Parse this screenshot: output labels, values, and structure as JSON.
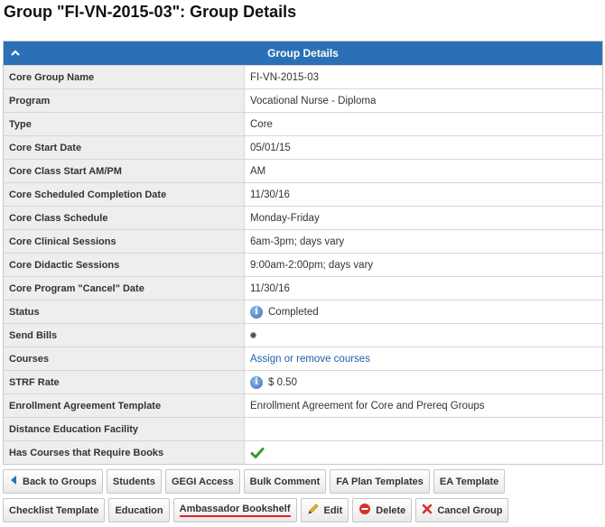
{
  "page": {
    "title": "Group \"FI-VN-2015-03\": Group Details"
  },
  "panel": {
    "header": "Group Details"
  },
  "details": [
    {
      "label": "Core Group Name",
      "value": "FI-VN-2015-03"
    },
    {
      "label": "Program",
      "value": "Vocational Nurse - Diploma"
    },
    {
      "label": "Type",
      "value": "Core"
    },
    {
      "label": "Core Start Date",
      "value": "05/01/15"
    },
    {
      "label": "Core Class Start AM/PM",
      "value": "AM"
    },
    {
      "label": "Core Scheduled Completion Date",
      "value": "11/30/16"
    },
    {
      "label": "Core Class Schedule",
      "value": "Monday-Friday"
    },
    {
      "label": "Core Clinical Sessions",
      "value": "6am-3pm; days vary"
    },
    {
      "label": "Core Didactic Sessions",
      "value": "9:00am-2:00pm; days vary"
    },
    {
      "label": "Core Program \"Cancel\" Date",
      "value": "11/30/16"
    },
    {
      "label": "Status",
      "value": "Completed",
      "icon": "info-icon"
    },
    {
      "label": "Send Bills",
      "value": "",
      "icon": "bullet-dot-icon"
    },
    {
      "label": "Courses",
      "value": "Assign or remove courses",
      "link": true
    },
    {
      "label": "STRF Rate",
      "value": "$ 0.50",
      "icon": "info-icon"
    },
    {
      "label": "Enrollment Agreement Template",
      "value": "Enrollment Agreement for Core and Prereq Groups"
    },
    {
      "label": "Distance Education Facility",
      "value": ""
    },
    {
      "label": "Has Courses that Require Books",
      "value": "",
      "icon": "green-check-icon"
    }
  ],
  "buttons": {
    "back": "Back to Groups",
    "students": "Students",
    "gegi": "GEGI Access",
    "bulk_comment": "Bulk Comment",
    "fa_plan": "FA Plan Templates",
    "ea_template": "EA Template",
    "checklist": "Checklist Template",
    "education": "Education",
    "ambassador": "Ambassador Bookshelf",
    "edit": "Edit",
    "delete": "Delete",
    "cancel_group": "Cancel Group"
  },
  "colors": {
    "header_bg": "#2b70b6",
    "label_bg": "#eeeeee",
    "link": "#1f5fa8",
    "highlight_underline": "#e0202a"
  }
}
